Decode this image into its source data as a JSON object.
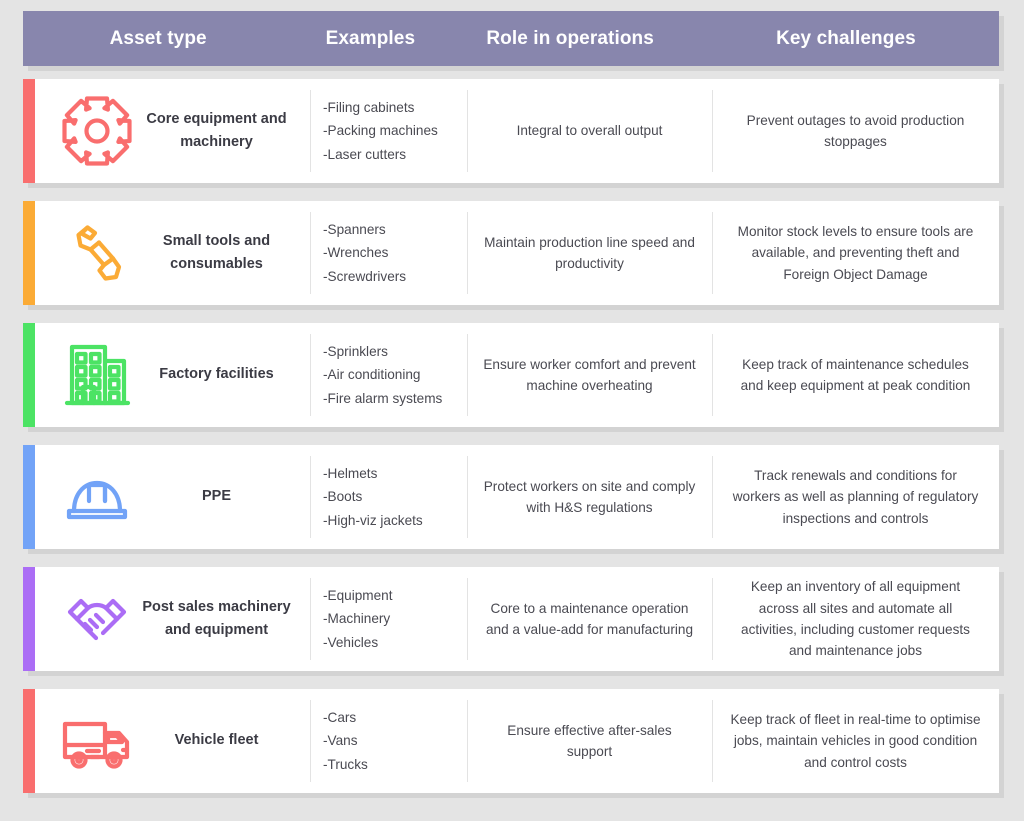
{
  "header": {
    "columns": [
      {
        "label": "Asset type"
      },
      {
        "label": "Examples"
      },
      {
        "label": "Role in operations"
      },
      {
        "label": "Key challenges"
      }
    ]
  },
  "colors": {
    "header_bar": "#8886ad",
    "page_background": "#e4e4e4",
    "card_background": "#ffffff",
    "accent_red": "#f96e6e",
    "accent_orange": "#fbab36",
    "accent_green": "#4ce364",
    "accent_blue": "#72a3f7",
    "accent_purple": "#ab6df5",
    "text_dark": "#3b3b44",
    "text_body": "#4a4a52"
  },
  "rows": [
    {
      "accent": "#f96e6e",
      "icon": "gear-icon",
      "icon_color": "#f96e6e",
      "asset_type": "Core equipment and machinery",
      "examples": "-Filing cabinets\n-Packing machines\n-Laser cutters",
      "role": "Integral to overall output",
      "challenges": "Prevent outages to avoid production stoppages"
    },
    {
      "accent": "#fbab36",
      "icon": "wrench-icon",
      "icon_color": "#fbab36",
      "asset_type": "Small tools and consumables",
      "examples": "-Spanners\n-Wrenches\n-Screwdrivers",
      "role": "Maintain production line speed and productivity",
      "challenges": "Monitor stock levels to ensure tools are available, and preventing theft and Foreign Object Damage"
    },
    {
      "accent": "#4ce364",
      "icon": "factory-building-icon",
      "icon_color": "#4ce364",
      "asset_type": "Factory facilities",
      "examples": "-Sprinklers\n-Air conditioning\n-Fire alarm systems",
      "role": "Ensure worker comfort and prevent machine overheating",
      "challenges": "Keep track of maintenance schedules and keep equipment at peak condition"
    },
    {
      "accent": "#72a3f7",
      "icon": "hard-hat-icon",
      "icon_color": "#72a3f7",
      "asset_type": "PPE",
      "examples": "-Helmets\n-Boots\n-High-viz jackets",
      "role": "Protect workers on site and comply with H&S regulations",
      "challenges": "Track renewals and conditions for workers as well as planning of regulatory inspections and controls"
    },
    {
      "accent": "#ab6df5",
      "icon": "handshake-icon",
      "icon_color": "#ab6df5",
      "asset_type": "Post sales machinery and equipment",
      "examples": "-Equipment\n-Machinery\n-Vehicles",
      "role": "Core to a maintenance operation and a value-add for manufacturing",
      "challenges": "Keep an inventory of all equipment across all sites and automate all activities, including customer requests and maintenance jobs"
    },
    {
      "accent": "#f96e6e",
      "icon": "truck-icon",
      "icon_color": "#f96e6e",
      "asset_type": "Vehicle fleet",
      "examples": "-Cars\n-Vans\n-Trucks",
      "role": "Ensure effective after-sales support",
      "challenges": "Keep track of fleet in real-time to optimise jobs, maintain vehicles in good condition and control costs"
    }
  ]
}
